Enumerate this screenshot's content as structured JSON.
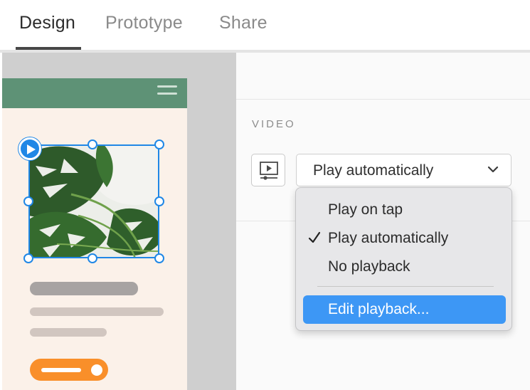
{
  "tabs": [
    {
      "label": "Design",
      "active": true
    },
    {
      "label": "Prototype",
      "active": false
    },
    {
      "label": "Share",
      "active": false
    }
  ],
  "panel": {
    "section_label": "VIDEO",
    "playback_select": {
      "value": "Play automatically"
    }
  },
  "playback_menu": {
    "items": [
      {
        "label": "Play on tap",
        "checked": false
      },
      {
        "label": "Play automatically",
        "checked": true
      },
      {
        "label": "No playback",
        "checked": false
      }
    ],
    "action": {
      "label": "Edit playback...",
      "highlighted": true
    }
  },
  "colors": {
    "accent": "#1f87e6",
    "menu_highlight": "#3d97f5",
    "artboard_header": "#5e9276",
    "artboard_bg": "#fbf1e9",
    "button_orange": "#f98f2a"
  },
  "icons": {
    "video_settings": "video-player-icon",
    "select_arrow": "chevron-down-icon",
    "play_badge": "play-icon",
    "menu_toggle": "hamburger-icon",
    "checked_item": "checkmark-icon"
  }
}
